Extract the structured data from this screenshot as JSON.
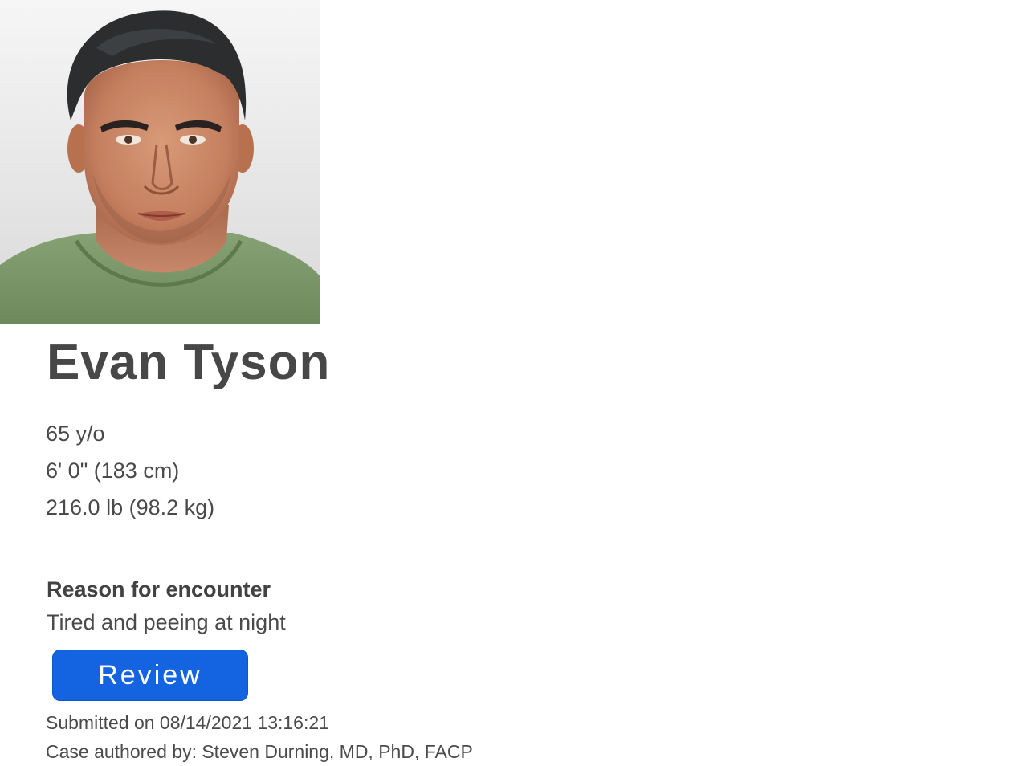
{
  "patient": {
    "name": "Evan Tyson",
    "age": "65 y/o",
    "height": "6' 0\" (183 cm)",
    "weight": "216.0 lb (98.2 kg)"
  },
  "encounter": {
    "reason_label": "Reason for encounter",
    "reason_text": "Tired and peeing at night"
  },
  "actions": {
    "review_label": "Review"
  },
  "meta": {
    "submitted": "Submitted on 08/14/2021 13:16:21",
    "author": "Case authored by: Steven Durning, MD, PhD, FACP"
  },
  "colors": {
    "button_bg": "#1463e0",
    "text": "#4a4a4a",
    "shirt": "#7a9668"
  }
}
